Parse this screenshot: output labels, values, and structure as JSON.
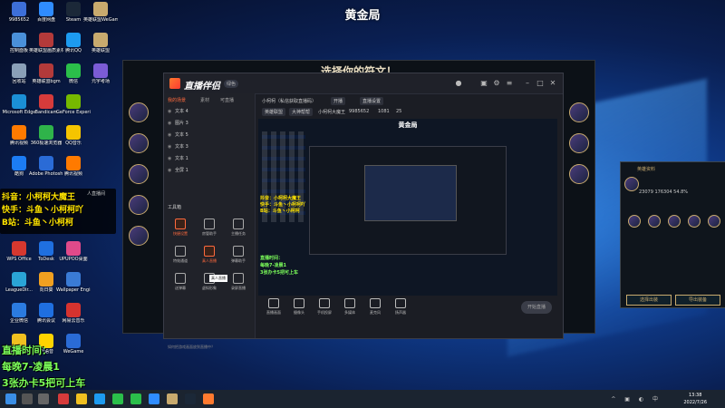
{
  "page_title": "黄金局",
  "desktop_icons": [
    {
      "label": "9985652",
      "color": "#3d6fd8"
    },
    {
      "label": "百度网盘",
      "color": "#2f8cff"
    },
    {
      "label": "Steam",
      "color": "#1b2838"
    },
    {
      "label": "英雄联盟WeGame版",
      "color": "#c8aa6e"
    },
    {
      "label": "控制面板",
      "color": "#4a90d9"
    },
    {
      "label": "英雄联盟画质素材",
      "color": "#b33a3a"
    },
    {
      "label": "腾讯QQ",
      "color": "#1d9bf0"
    },
    {
      "label": "英雄联盟",
      "color": "#c8aa6e"
    },
    {
      "label": "回收站",
      "color": "#8aa0b8"
    },
    {
      "label": "英雄联盟bgm",
      "color": "#b33a3a"
    },
    {
      "label": "微信",
      "color": "#2bbf4a"
    },
    {
      "label": "元宇考场",
      "color": "#7b5cd6"
    },
    {
      "label": "Microsoft Edge",
      "color": "#1b8fd6"
    },
    {
      "label": "Bandicam",
      "color": "#d63b3b"
    },
    {
      "label": "GeForce Experience",
      "color": "#76b900"
    },
    {
      "label": "",
      "color": "#00000000"
    },
    {
      "label": "腾讯视频",
      "color": "#ff7a00"
    },
    {
      "label": "360极速浏览器",
      "color": "#2fb34a"
    },
    {
      "label": "QQ音乐",
      "color": "#f5c400"
    },
    {
      "label": "",
      "color": "#00000000"
    },
    {
      "label": "酷狗",
      "color": "#1c7cf4"
    },
    {
      "label": "Adobe Photosh...",
      "color": "#2a6bd6"
    },
    {
      "label": "腾讯视频",
      "color": "#ff7a00"
    },
    {
      "label": "",
      "color": "#00000000"
    },
    {
      "label": "WPS Office",
      "color": "#d6382f"
    },
    {
      "label": "ToDesk",
      "color": "#1f6fe0"
    },
    {
      "label": "UPUPOO桌面",
      "color": "#e04a8a"
    },
    {
      "label": "",
      "color": "#00000000"
    },
    {
      "label": "LeagueDir...",
      "color": "#2aa4d6"
    },
    {
      "label": "向日葵",
      "color": "#f0a020"
    },
    {
      "label": "Wallpaper Engine:...",
      "color": "#3a7bd5"
    },
    {
      "label": "",
      "color": "#00000000"
    },
    {
      "label": "企业微信",
      "color": "#2b7be0"
    },
    {
      "label": "腾讯会议",
      "color": "#1f6fe0"
    },
    {
      "label": "网易云音乐",
      "color": "#d6332f"
    },
    {
      "label": "",
      "color": "#00000000"
    },
    {
      "label": "谷歌管理",
      "color": "#f0c020"
    },
    {
      "label": "YY语音",
      "color": "#ffd400"
    },
    {
      "label": "WeGame",
      "color": "#2a6bd6"
    }
  ],
  "overlay": {
    "lines": [
      "抖音：小柯柯大魔王",
      "快手：斗鱼丶小柯柯吖",
      "B站：斗鱼丶小柯柯"
    ],
    "note": "人直播间",
    "hours": [
      "直播时间：",
      "每晚7-凌晨1",
      "3张办卡5把可上车"
    ]
  },
  "game": {
    "title": "选择你的符文！"
  },
  "app": {
    "name": "直播伴侣",
    "version": "绿色",
    "left_tabs": [
      "我的场景",
      "素材",
      "可直播"
    ],
    "scenes": [
      "文本 4",
      "图片 3",
      "文本 5",
      "文本 3",
      "文本 1",
      "全屏 1"
    ],
    "tools_header": "工具箱",
    "tools": [
      {
        "label": "快捷设置",
        "hot": true
      },
      {
        "label": "房管助手",
        "hot": false
      },
      {
        "label": "主播任务",
        "hot": false
      },
      {
        "label": "特效通道",
        "hot": false
      },
      {
        "label": "真人直播",
        "hot": true
      },
      {
        "label": "弹幕助手",
        "hot": false
      },
      {
        "label": "送弹幕",
        "hot": false
      },
      {
        "label": "虚拟形象",
        "hot": false
      },
      {
        "label": "录屏直播",
        "hot": false
      }
    ],
    "tooltip": "真人直播",
    "bottom_note": "如何把游戏画面放到直播中？",
    "info": {
      "room": "小柯柯（私信获取直播码）",
      "badge": "开播",
      "settings": "直播设置",
      "category": "英雄联盟",
      "partition": "大神帮帮",
      "id_line": "小柯柯大魔王",
      "fans": "9985652",
      "stat1": "1081",
      "stat2": "25"
    },
    "preview_title": "黄金局",
    "preview_overlay": [
      "抖音：小柯柯大魔王",
      "快手：斗鱼丶小柯柯吖",
      "B站：斗鱼丶小柯柯"
    ],
    "preview_hours": [
      "直播时间：",
      "每晚7-凌晨1",
      "3张办卡5把可上车"
    ],
    "controls": [
      "直播画面",
      "摄像头",
      "手机投屏",
      "多媒体",
      "麦克风",
      "扬声器"
    ],
    "start_button": "开始直播"
  },
  "right_panel": {
    "title": "英雄资料",
    "stats": "23079  176304  54.8%",
    "buttons": [
      "选择出装",
      "导出装备"
    ]
  },
  "clock": {
    "time": "13:38",
    "date": "2022/7/26"
  }
}
